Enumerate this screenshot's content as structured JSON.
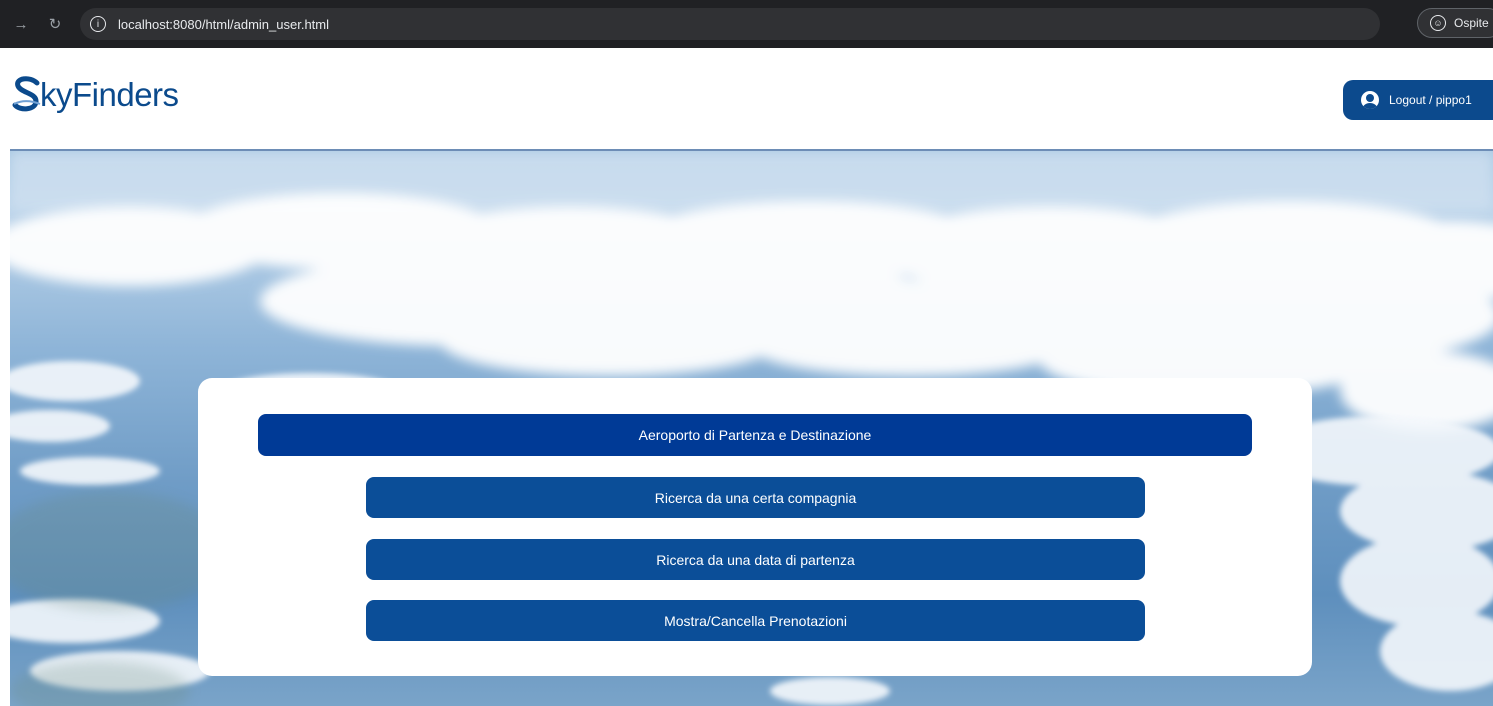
{
  "browser": {
    "url": "localhost:8080/html/admin_user.html",
    "profile_label": "Ospite",
    "icons": [
      "forward-arrow-icon",
      "reload-icon",
      "info-icon",
      "profile-icon"
    ]
  },
  "header": {
    "logo_text": "kyFinders",
    "logout_label": "Logout / pippo1"
  },
  "menu": {
    "primary_label": "Aeroporto di Partenza e Destinazione",
    "items": [
      "Ricerca da una certa compagnia",
      "Ricerca da una data di partenza",
      "Mostra/Cancella Prenotazioni"
    ]
  },
  "colors": {
    "brand": "#0b4a8c",
    "primary_button": "#003a96",
    "secondary_button": "#0b4e98"
  }
}
